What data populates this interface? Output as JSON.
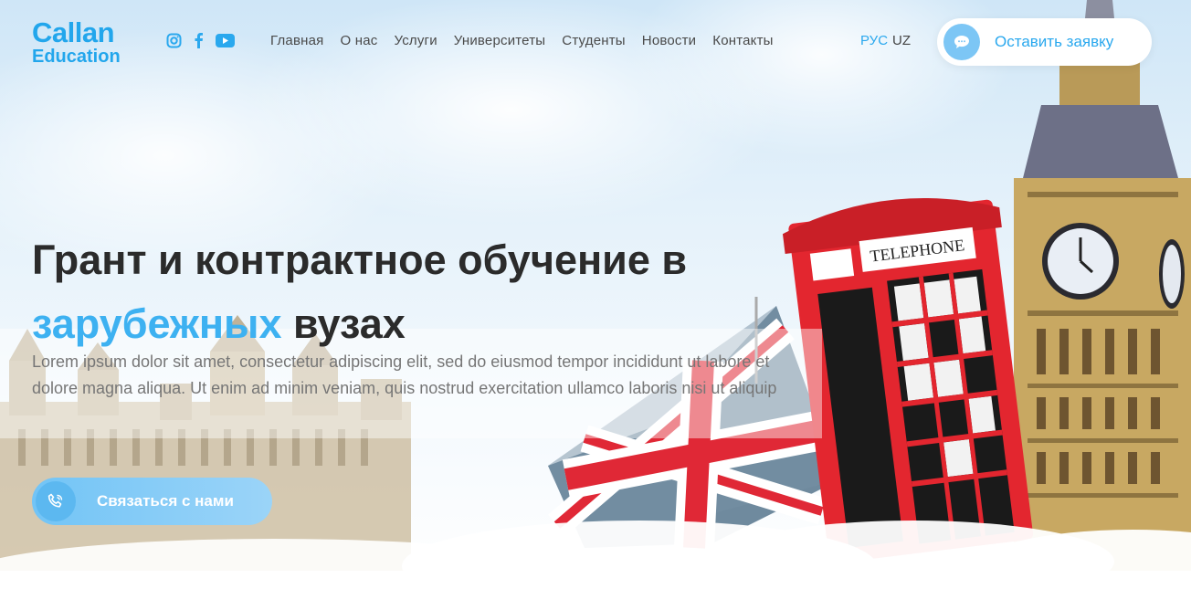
{
  "header": {
    "logo": {
      "line1": "Callan",
      "line2": "Education"
    },
    "socials": [
      "instagram-icon",
      "facebook-icon",
      "youtube-icon"
    ],
    "nav": [
      "Главная",
      "О нас",
      "Услуги",
      "Университеты",
      "Студенты",
      "Новости",
      "Контакты"
    ],
    "lang": {
      "active": "РУС",
      "other": "UZ"
    },
    "cta": {
      "label": "Оставить заявку",
      "icon": "chat-bubble-icon"
    }
  },
  "hero": {
    "title_part1": "Грант и контрактное обучение в",
    "title_accent": "зарубежных",
    "title_part2": "вузах",
    "description": "Lorem ipsum dolor sit amet, consectetur adipiscing elit, sed do eiusmod tempor incididunt ut labore et dolore magna aliqua. Ut enim ad minim veniam, quis nostrud exercitation ullamco laboris nisi ut aliquip",
    "cta": {
      "label": "Связаться с нами",
      "icon": "phone-icon"
    },
    "phone_booth_sign": "TELEPHONE"
  },
  "colors": {
    "accent": "#22a6ec",
    "booth_red": "#e3262f"
  }
}
